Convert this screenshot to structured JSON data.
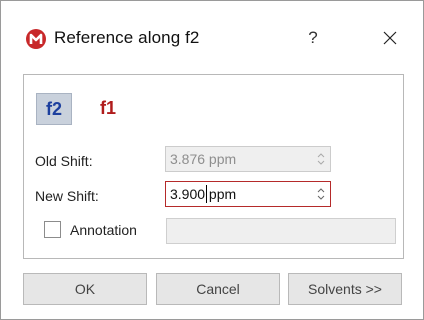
{
  "window": {
    "title": "Reference along f2",
    "help_label": "?",
    "app_icon": "mnova-logo-icon",
    "accent_color": "#c8282a"
  },
  "tabs": {
    "f2_label": "f2",
    "f1_label": "f1",
    "selected": "f2"
  },
  "fields": {
    "old_shift_label": "Old Shift:",
    "old_shift_value": "3.876 ppm",
    "new_shift_label": "New Shift:",
    "new_shift_value_part1": "3.900",
    "new_shift_value_part2": " ppm",
    "annotation_label": "Annotation",
    "annotation_checked": false,
    "annotation_value": ""
  },
  "buttons": {
    "ok": "OK",
    "cancel": "Cancel",
    "solvents": "Solvents >>"
  }
}
